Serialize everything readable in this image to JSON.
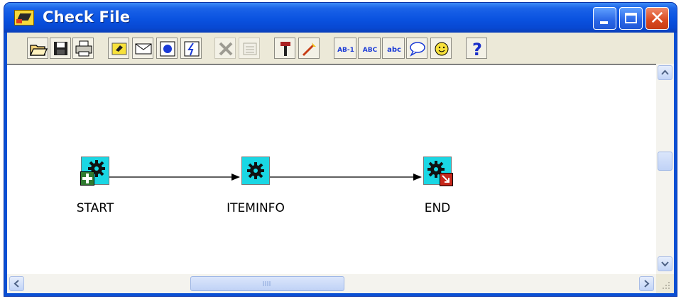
{
  "window": {
    "title": "Check File",
    "title_icon": "check-file-app-icon",
    "controls": {
      "minimize_icon": "minimize-icon",
      "maximize_icon": "maximize-icon",
      "close_glyph": "✕"
    }
  },
  "colors": {
    "titlebar": "#0a52e0",
    "toolbar_bg": "#ece9d8",
    "node_fill": "#1ad7e4",
    "canvas_bg": "#ffffff"
  },
  "toolbar": {
    "buttons": [
      {
        "icon": "open-folder-icon"
      },
      {
        "icon": "save-icon"
      },
      {
        "icon": "print-icon"
      },
      {
        "icon": "new-process-icon"
      },
      {
        "icon": "message-icon"
      },
      {
        "icon": "function-icon"
      },
      {
        "icon": "event-icon"
      },
      {
        "icon": "delete-icon",
        "disabled": true
      },
      {
        "icon": "properties-icon",
        "disabled": true
      },
      {
        "icon": "hammer-icon"
      },
      {
        "icon": "transition-icon"
      },
      {
        "icon": "label-ab1-icon",
        "text": "AB-1"
      },
      {
        "icon": "label-upper-icon",
        "text": "ABC"
      },
      {
        "icon": "label-lower-icon",
        "text": "abc"
      },
      {
        "icon": "comment-icon"
      },
      {
        "icon": "smiley-icon"
      },
      {
        "icon": "help-icon",
        "text": "?"
      }
    ]
  },
  "diagram": {
    "nodes": [
      {
        "id": "start",
        "label": "START",
        "badge": "start-badge-icon"
      },
      {
        "id": "iteminfo",
        "label": "ITEMINFO",
        "badge": ""
      },
      {
        "id": "end",
        "label": "END",
        "badge": "end-badge-icon"
      }
    ],
    "edges": [
      {
        "from": "start",
        "to": "iteminfo"
      },
      {
        "from": "iteminfo",
        "to": "end"
      }
    ]
  },
  "scrollbars": {
    "vertical": {
      "up_icon": "scroll-up-icon",
      "down_icon": "scroll-down-icon"
    },
    "horizontal": {
      "left_icon": "scroll-left-icon",
      "right_icon": "scroll-right-icon"
    }
  }
}
